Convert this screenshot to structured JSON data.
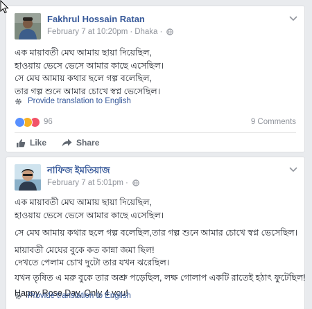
{
  "posts": [
    {
      "author": "Fakhrul Hossain Ratan",
      "date": "February 7 at 10:20pm",
      "location": "Dhaka",
      "body": [
        "এক মায়াবতী মেঘ আমায় ছায়া দিয়েছিল,",
        "হাওয়ায় ভেসে ভেসে আমার কাছে এসেছিল।",
        "সে মেঘ আমায় কথার ছলে গল্প বলেছিল,",
        "তার গল্প শুনে আমার চোখে স্বপ্ন ভেসেছিল।"
      ],
      "translate": "Provide translation to English",
      "reactions_count": "96",
      "comments": "9 Comments",
      "actions": {
        "like": "Like",
        "share": "Share"
      }
    },
    {
      "author": "নাফিজ ইমতিয়াজ",
      "date": "February 7 at 5:01pm",
      "body": [
        "এক মায়াবতী মেঘ আমায় ছায়া দিয়েছিল,",
        "হাওয়ায় ভেসে ভেসে আমার কাছে এসেছিল।",
        "সে মেঘ আমায় কথার ছলে গল্প বলেছিল,তার গল্প শুনে আমার চোখে স্বপ্ন ভেসেছিল।",
        "মায়াবতী মেঘের বুকে কত কান্না জমা ছিল!",
        "দেখতে পেলাম চোখ দুটো তার যখন ঝরেছিল।",
        "যখন তৃষিত এ মরু বুকে তার অশ্রু পড়েছিল, লক্ষ গোলাপ একটি রাতেই হঠাৎ ফুটেছিল!",
        "Happy Rose Day, Only 4 you!"
      ],
      "translate": "Provide translation to English"
    }
  ]
}
